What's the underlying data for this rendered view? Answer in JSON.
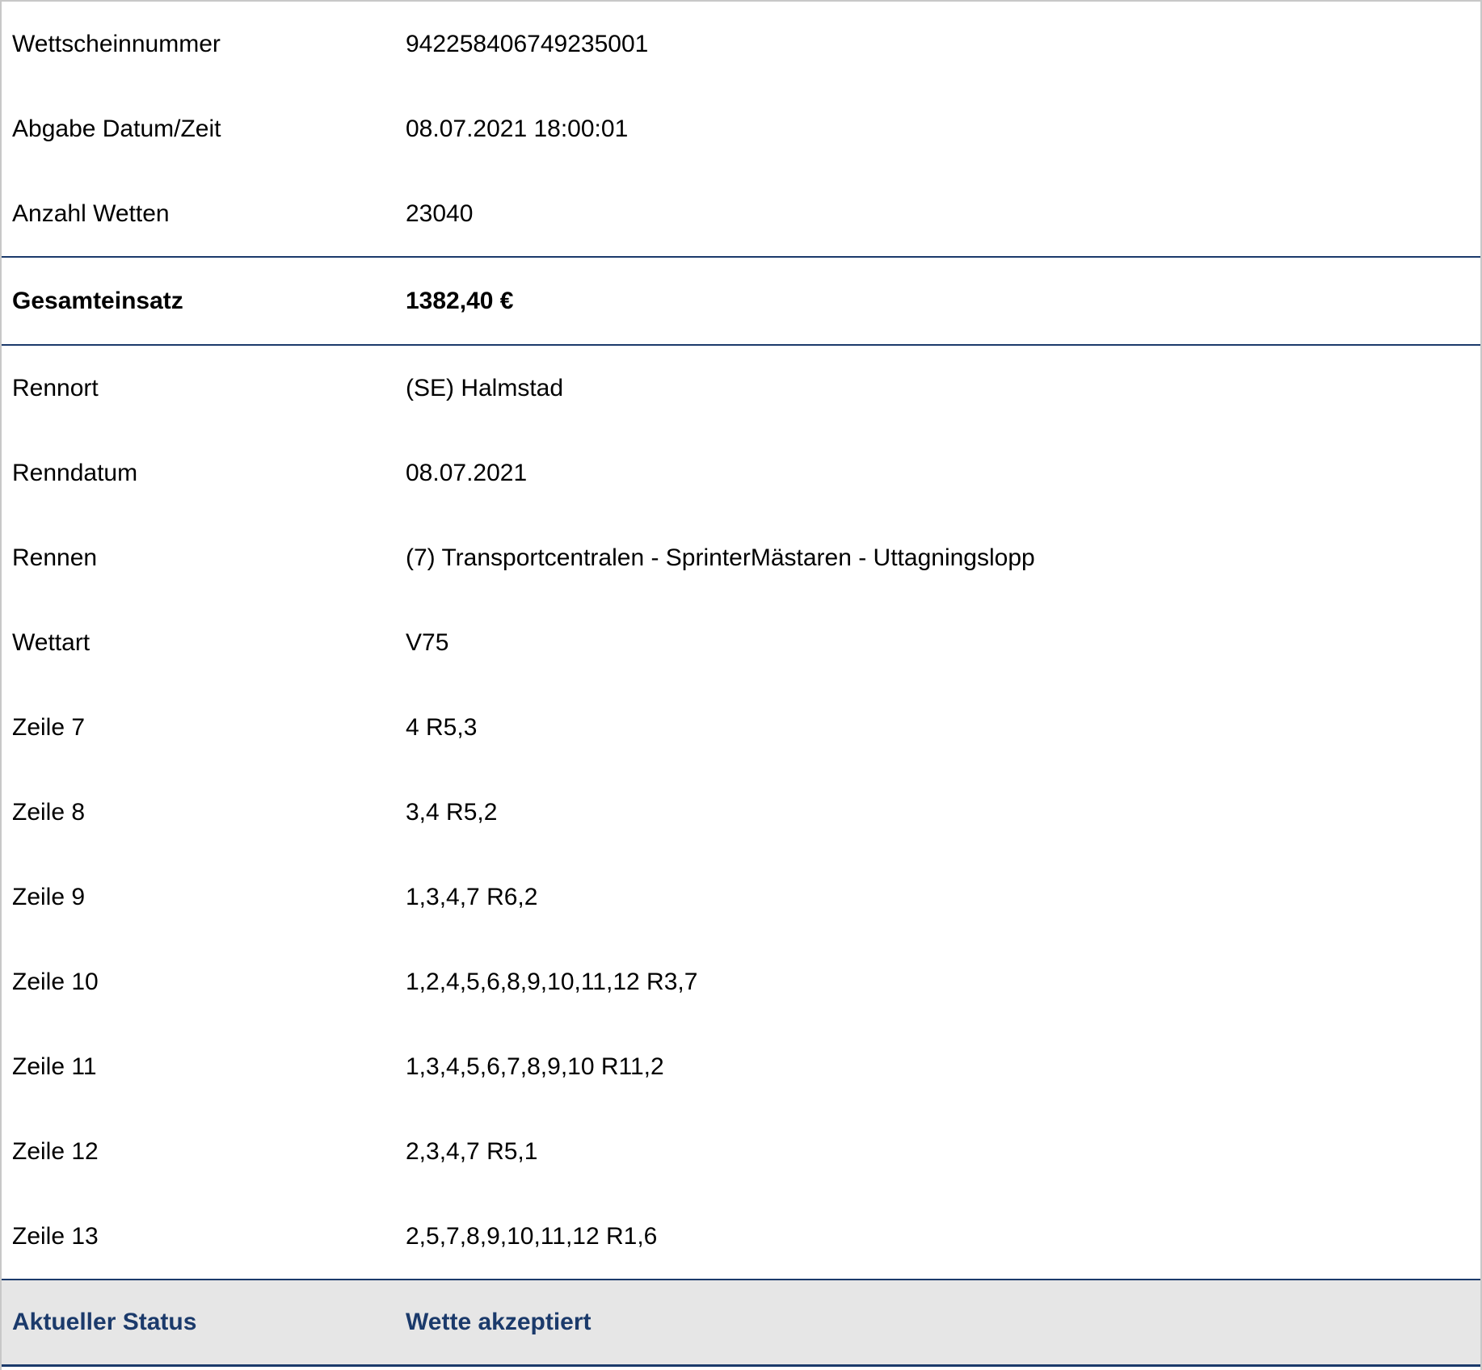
{
  "header_rows": [
    {
      "label": "Wettscheinnummer",
      "value": "942258406749235001"
    },
    {
      "label": "Abgabe Datum/Zeit",
      "value": "08.07.2021 18:00:01"
    },
    {
      "label": "Anzahl Wetten",
      "value": "23040"
    }
  ],
  "total": {
    "label": "Gesamteinsatz",
    "value": "1382,40 €"
  },
  "detail_rows": [
    {
      "label": "Rennort",
      "value": "(SE) Halmstad"
    },
    {
      "label": "Renndatum",
      "value": "08.07.2021"
    },
    {
      "label": "Rennen",
      "value": "(7) Transportcentralen - SprinterMästaren - Uttagningslopp"
    },
    {
      "label": "Wettart",
      "value": "V75"
    },
    {
      "label": "Zeile 7",
      "value": "4 R5,3"
    },
    {
      "label": "Zeile 8",
      "value": "3,4 R5,2"
    },
    {
      "label": "Zeile 9",
      "value": "1,3,4,7 R6,2"
    },
    {
      "label": "Zeile 10",
      "value": "1,2,4,5,6,8,9,10,11,12 R3,7"
    },
    {
      "label": "Zeile 11",
      "value": "1,3,4,5,6,7,8,9,10 R11,2"
    },
    {
      "label": "Zeile 12",
      "value": "2,3,4,7 R5,1"
    },
    {
      "label": "Zeile 13",
      "value": "2,5,7,8,9,10,11,12 R1,6"
    }
  ],
  "status": {
    "label": "Aktueller Status",
    "value": "Wette akzeptiert"
  },
  "colors": {
    "accent_navy": "#1b3a6b",
    "status_background": "#e6e6e6"
  }
}
